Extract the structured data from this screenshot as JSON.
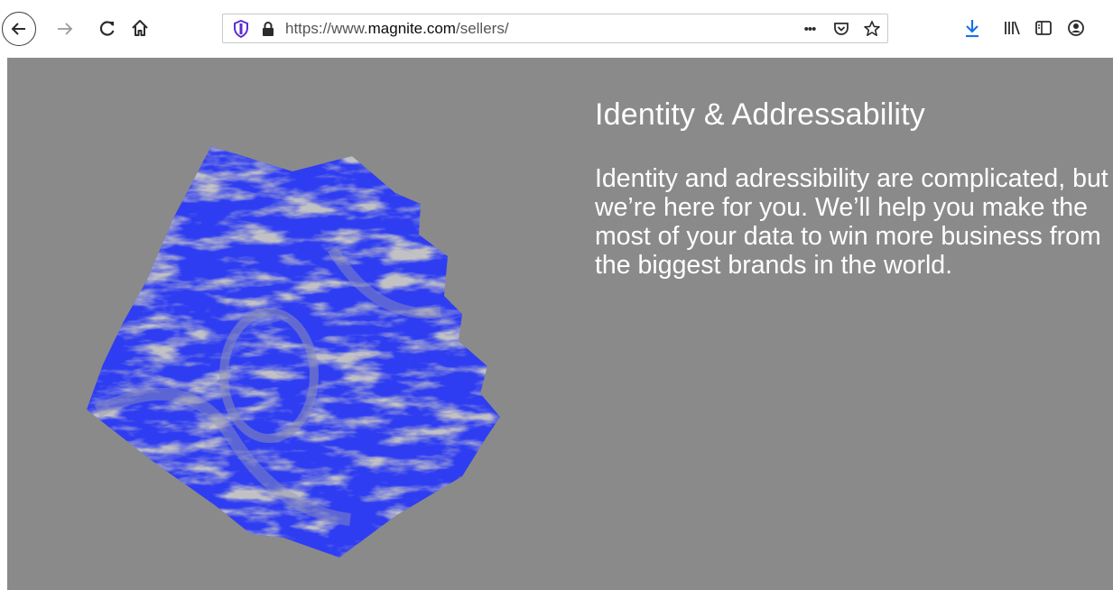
{
  "browser": {
    "url": {
      "prefix": "https://www.",
      "host": "magnite.com",
      "path": "/sellers/"
    },
    "overflow_menu_glyph": "•••",
    "icons": [
      "back-icon",
      "forward-icon",
      "reload-icon",
      "home-icon",
      "shield-icon",
      "lock-icon",
      "pocket-icon",
      "star-icon",
      "download-icon",
      "library-icon",
      "sidebar-icon",
      "account-icon"
    ],
    "accent_color": "#1a73e8"
  },
  "page": {
    "heading": "Identity & Addressability",
    "body": "Identity and adressibility are complicated, but we’re here for you. We’ll help you make the most of your data to win more business from the biggest brands in the world.",
    "background_color": "#8a8a8a",
    "graphic_color": "#2f3df2"
  }
}
